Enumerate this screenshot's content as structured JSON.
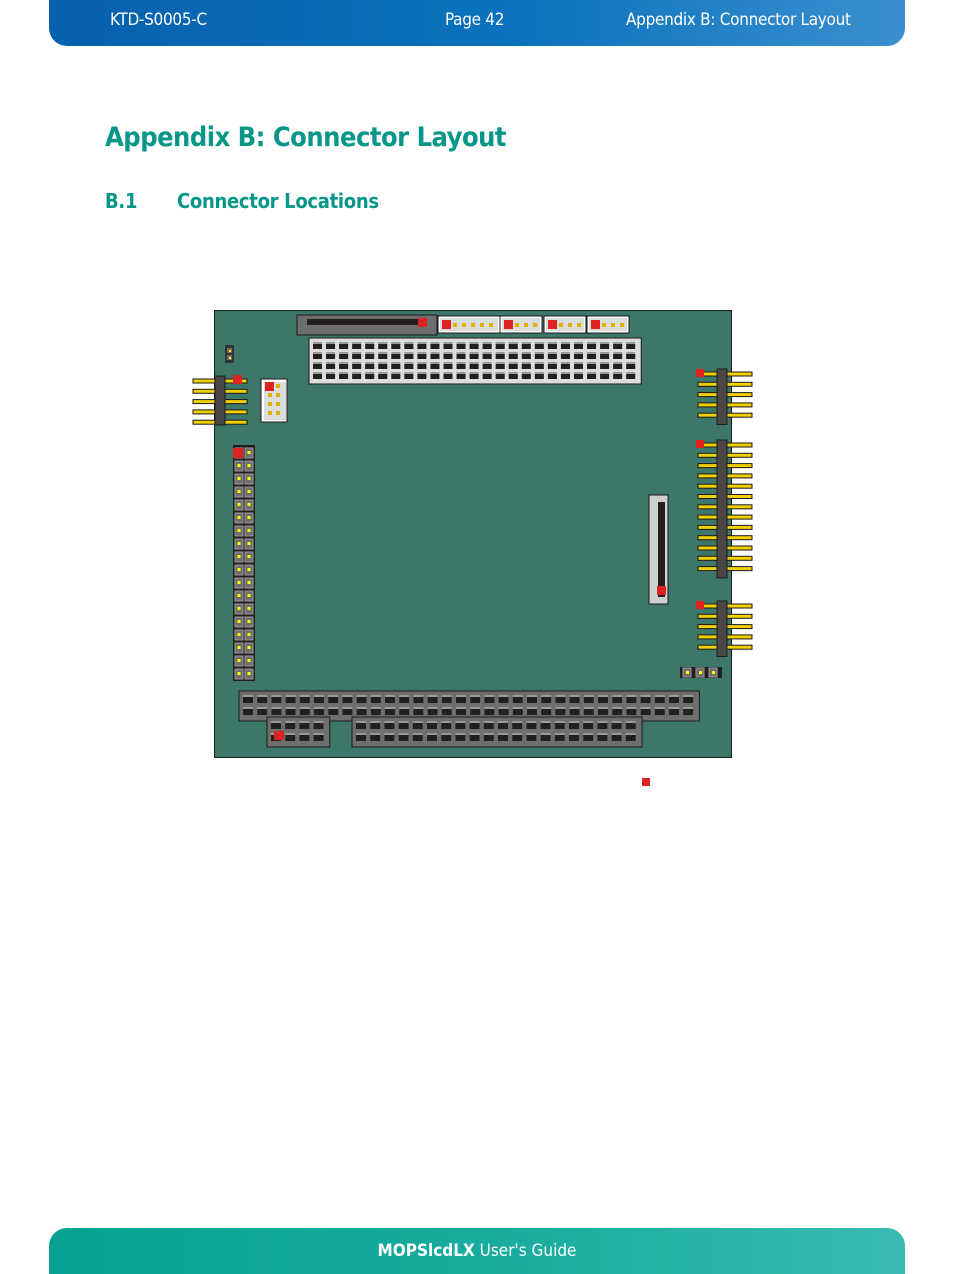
{
  "header": {
    "doc_id": "KTD-S0005-C",
    "page": "Page 42",
    "section": "Appendix B: Connector Layout"
  },
  "title": "Appendix B: Connector Layout",
  "subsection": {
    "number": "B.1",
    "title": "Connector Locations"
  },
  "diagram": {
    "description": "Board top view with connector positions; red square marks pin 1",
    "colors": {
      "board": "#3c776a",
      "pin1": "#dd2222",
      "pin": "#f2d000",
      "housing_dark": "#6e6e6e",
      "housing_light": "#dcdcdc"
    },
    "connectors": [
      {
        "name": "top-slot-connector",
        "cols": 1,
        "rows": 1
      },
      {
        "name": "top-4row-header",
        "cols": 25,
        "rows": 4
      },
      {
        "name": "top-small-header-1",
        "pins": 6
      },
      {
        "name": "top-small-header-2",
        "pins": 4
      },
      {
        "name": "top-small-header-3",
        "pins": 4
      },
      {
        "name": "top-small-header-4",
        "pins": 4
      },
      {
        "name": "left-2pin-jumper",
        "pins": 2
      },
      {
        "name": "left-angled-header",
        "pins": 5
      },
      {
        "name": "left-box-header",
        "cols": 2,
        "rows": 4
      },
      {
        "name": "left-vertical-header",
        "cols": 2,
        "rows": 18
      },
      {
        "name": "right-angled-header-1",
        "pins": 5
      },
      {
        "name": "right-angled-header-2",
        "pins": 13
      },
      {
        "name": "right-angled-header-3",
        "pins": 5
      },
      {
        "name": "vertical-slot-connector",
        "pins": 1
      },
      {
        "name": "right-3pin-jumper",
        "pins": 3
      },
      {
        "name": "bottom-long-header",
        "cols": 32,
        "rows": 2
      },
      {
        "name": "bottom-small-header",
        "cols": 4,
        "rows": 2
      },
      {
        "name": "bottom-right-header",
        "cols": 20,
        "rows": 2
      }
    ],
    "legend_marker": "pin-1-marker"
  },
  "footer": {
    "product": "MOPSlcdLX",
    "suffix": " User's Guide"
  }
}
